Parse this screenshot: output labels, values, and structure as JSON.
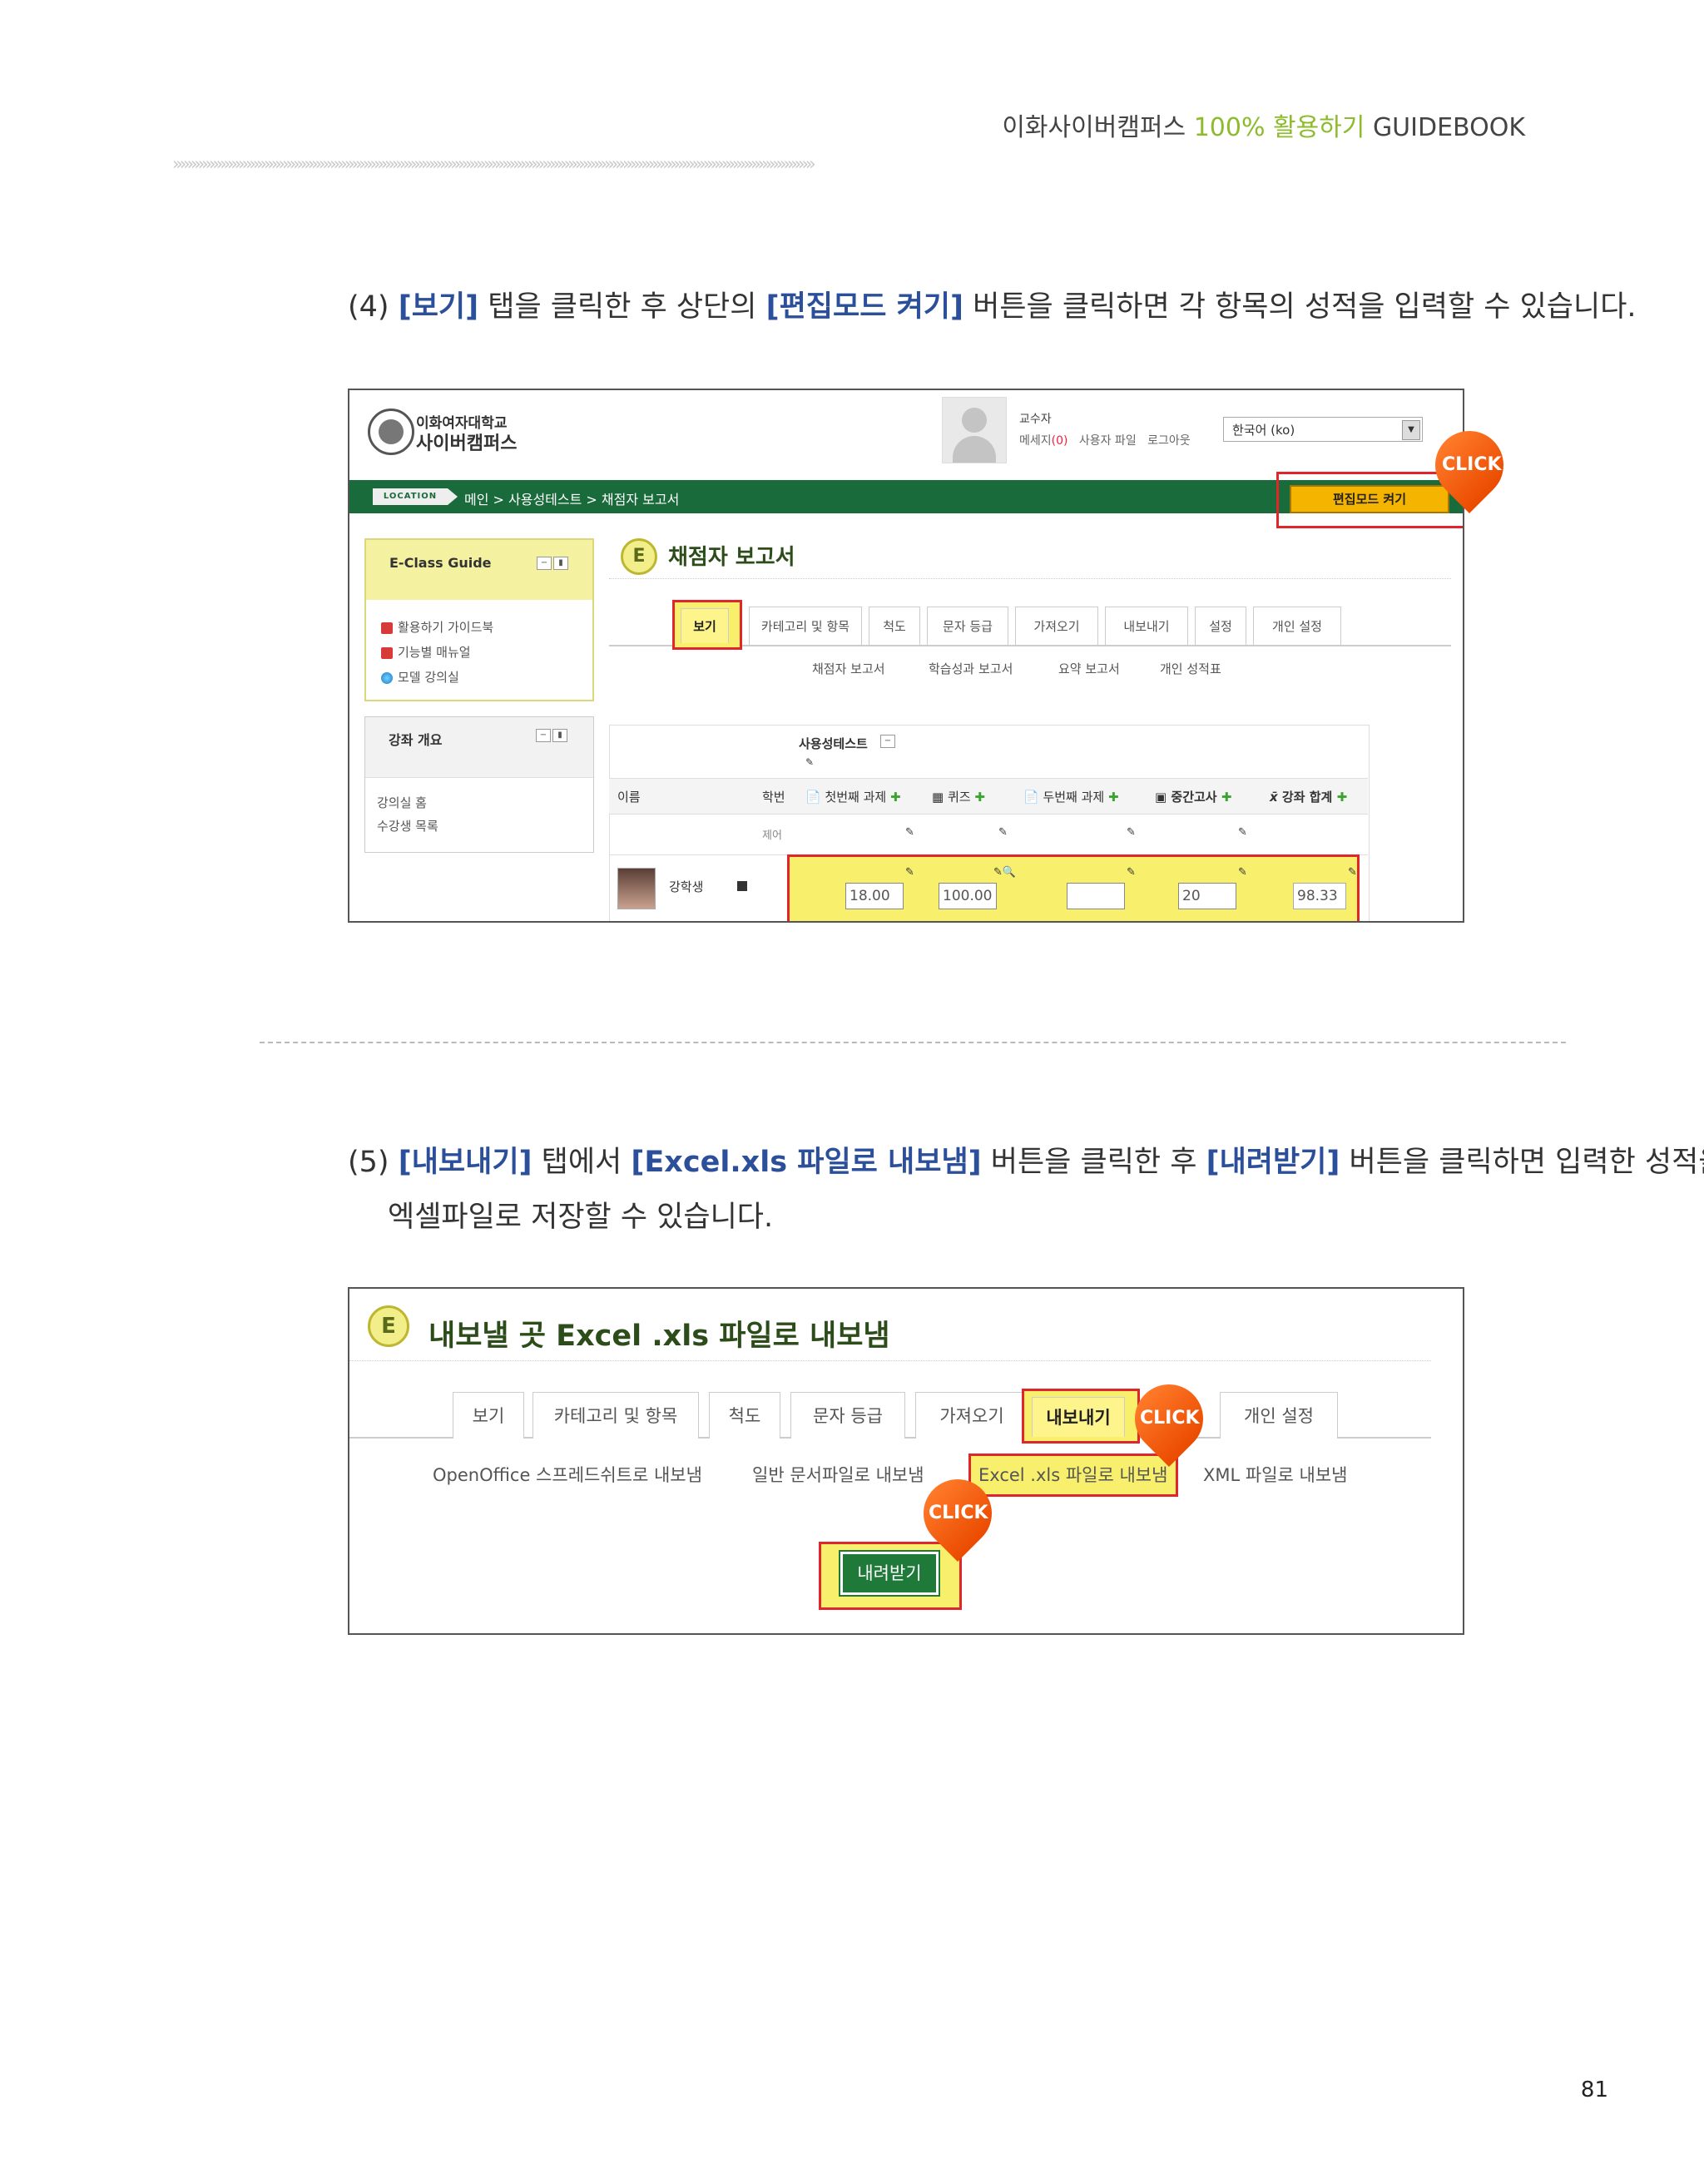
{
  "header": {
    "title_part1": "이화사이버캠퍼스",
    "title_highlight": "100% 활용하기",
    "title_part2": "GUIDEBOOK",
    "chevrons": "›››››››››››››››››››››››››››››››››››››››››››››››››››››››››››››››››››››››››››››››››››››››››››››››››››››››››››››››››››››››››››››››››››››››››››››››››››››››››››››››››››››››››››››››"
  },
  "step4": {
    "num": "(4)",
    "kw1": "[보기]",
    "t1": "탭을 클릭한 후 상단의",
    "kw2": "[편집모드 켜기]",
    "t2": "버튼을 클릭하면 각 항목의 성적을 입력할 수 있습니다."
  },
  "shot1": {
    "logo_line1": "이화여자대학교",
    "logo_line2": "사이버캠퍼스",
    "user_role": "교수자",
    "msg_label": "메세지",
    "msg_count": "(0)",
    "user_files": "사용자 파일",
    "logout": "로그아웃",
    "language": "한국어 (ko)",
    "location_tag": "LOCATION",
    "breadcrumb": "메인  >  사용성테스트  >  채점자 보고서",
    "edit_button": "편집모드 켜기",
    "click": "CLICK",
    "sidebar": {
      "block1_title": "E-Class Guide",
      "block1_items": [
        "활용하기 가이드북",
        "기능별 매뉴얼",
        "모델 강의실"
      ],
      "block2_title": "강좌 개요",
      "block2_items": [
        "강의실 홈",
        "수강생 목록"
      ]
    },
    "page_title": "채점자 보고서",
    "tabs": [
      "보기",
      "카테고리 및 항목",
      "척도",
      "문자 등급",
      "가져오기",
      "내보내기",
      "설정",
      "개인 설정"
    ],
    "subtabs": [
      "채점자 보고서",
      "학습성과 보고서",
      "요약 보고서",
      "개인 성적표"
    ],
    "course_name": "사용성테스트",
    "columns": {
      "name": "이름",
      "id": "학번",
      "c1": "첫번째 과제",
      "c2": "퀴즈",
      "c3": "두번째 과제",
      "c4": "중간고사",
      "c5": "강좌 합계"
    },
    "control_row": "제어",
    "student": {
      "name": "강학생",
      "scores": [
        "18.00",
        "100.00",
        "",
        "20",
        "98.33"
      ]
    }
  },
  "step5": {
    "num": "(5)",
    "kw1": "[내보내기]",
    "t1": "탭에서",
    "kw2": "[Excel.xls 파일로 내보냄]",
    "t2": "버튼을 클릭한 후",
    "kw3": "[내려받기]",
    "t3": "버튼을 클릭하면 입력한 성적을",
    "line2": "엑셀파일로 저장할 수 있습니다."
  },
  "shot2": {
    "title": "내보낼 곳 Excel .xls 파일로 내보냄",
    "tabs": [
      "보기",
      "카테고리 및 항목",
      "척도",
      "문자 등급",
      "가져오기",
      "내보내기",
      "개인 설정"
    ],
    "subtabs": [
      "OpenOffice 스프레드쉬트로 내보냄",
      "일반 문서파일로 내보냄",
      "Excel .xls 파일로 내보냄",
      "XML 파일로 내보냄"
    ],
    "download_button": "내려받기",
    "click": "CLICK"
  },
  "page_number": "81"
}
